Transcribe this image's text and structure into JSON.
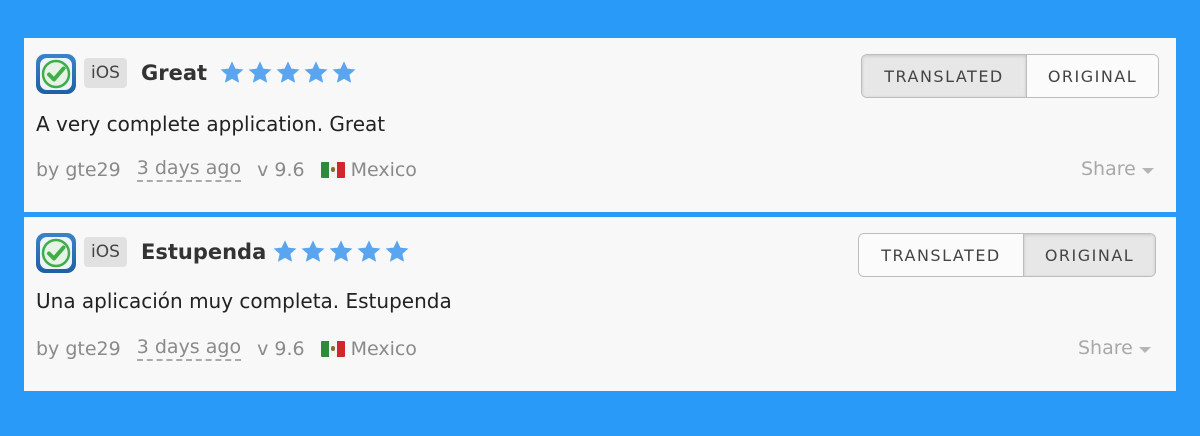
{
  "reviews": [
    {
      "platform": "iOS",
      "title": "Great",
      "rating": 5,
      "rating_max": 5,
      "toggle": {
        "translated": "TRANSLATED",
        "original": "ORIGINAL",
        "active": "translated"
      },
      "body": "A very complete application. Great",
      "author": "by gte29",
      "date": "3 days ago",
      "version": "v 9.6",
      "country": "Mexico",
      "flag_icon": "mexico-flag-icon",
      "share": "Share"
    },
    {
      "platform": "iOS",
      "title": "Estupenda",
      "rating": 5,
      "rating_max": 5,
      "toggle": {
        "translated": "TRANSLATED",
        "original": "ORIGINAL",
        "active": "original"
      },
      "body": "Una aplicación muy completa. Estupenda",
      "author": "by gte29",
      "date": "3 days ago",
      "version": "v 9.6",
      "country": "Mexico",
      "flag_icon": "mexico-flag-icon",
      "share": "Share"
    }
  ],
  "colors": {
    "background": "#2a9af9",
    "card": "#f8f8f8",
    "star": "#5aa5ef"
  }
}
